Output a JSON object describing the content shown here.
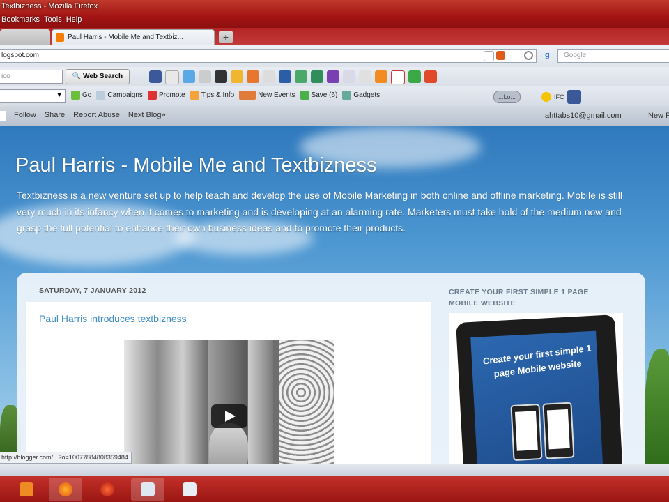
{
  "window": {
    "title": "Textbizness - Mozilla Firefox",
    "menu": [
      "Bookmarks",
      "Tools",
      "Help"
    ]
  },
  "tabs": [
    {
      "label": "",
      "active": false
    },
    {
      "label": "Paul Harris - Mobile Me and Textbiz...",
      "active": true
    }
  ],
  "nav": {
    "url": "logspot.com",
    "search_engine": "g",
    "search_placeholder": "Google"
  },
  "toolbar1": {
    "search_value": "ico",
    "web_search_label": "Web Search"
  },
  "toolbar2": {
    "items": [
      "Go",
      "Campaigns",
      "Promote",
      "Tips & Info",
      "New Events",
      "Save (6)",
      "Gadgets"
    ],
    "right_pill": "...Lo...",
    "ifc": "IFC"
  },
  "blogger_bar": {
    "links": [
      "Follow",
      "Share",
      "Report Abuse",
      "Next Blog»"
    ],
    "email": "ahttabs10@gmail.com",
    "new_post": "New Post"
  },
  "blog": {
    "title": "Paul Harris - Mobile Me and Textbizness",
    "description": "Textbizness is a new venture set up to help teach and develop the use of Mobile Marketing in both online and offline marketing. Mobile is still very much in its infancy when it comes to marketing and is developing at an alarming rate. Marketers must take hold of the medium now and grasp the full potential to enhance their own business ideas and to promote their products.",
    "post_date": "SATURDAY, 7 JANUARY 2012",
    "post_title": "Paul Harris introduces textbizness",
    "sidebar_title": "CREATE YOUR FIRST SIMPLE 1 PAGE MOBILE WEBSITE",
    "widget_text": "Create your first simple 1 page Mobile website"
  },
  "status_text": "http://blogger.com/...?o=10077884808359484",
  "colors": {
    "accent": "#3d8cc8",
    "taskbar": "#b0201b",
    "sky": "#3c86c6"
  }
}
